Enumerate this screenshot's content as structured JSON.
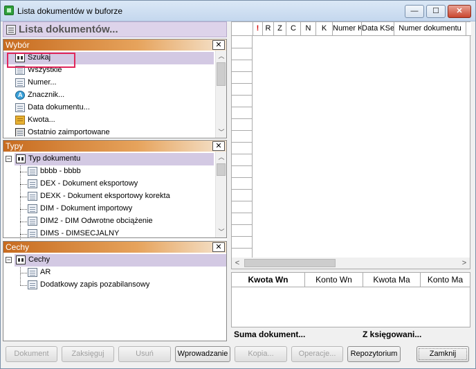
{
  "window": {
    "title": "Lista dokumentów w buforze",
    "min": "—",
    "max": "☐",
    "close": "✕"
  },
  "left_header": {
    "title": "Lista dokumentów..."
  },
  "wybor": {
    "title": "Wybór",
    "close": "✕",
    "items": [
      {
        "label": "Szukaj",
        "icon": "binoculars-icon"
      },
      {
        "label": "Wszystkie",
        "icon": "list-icon"
      },
      {
        "label": "Numer...",
        "icon": "list-icon"
      },
      {
        "label": "Znacznik...",
        "icon": "marker-icon"
      },
      {
        "label": "Data dokumentu...",
        "icon": "list-icon"
      },
      {
        "label": "Kwota...",
        "icon": "coins-icon"
      },
      {
        "label": "Ostatnio zaimportowane",
        "icon": "import-icon"
      }
    ]
  },
  "typy": {
    "title": "Typy",
    "close": "✕",
    "root": "Typ dokumentu",
    "items": [
      "bbbb - bbbb",
      "DEX - Dokument eksportowy",
      "DEXK - Dokument eksportowy korekta",
      "DIM - Dokument importowy",
      "DIM2 - DIM Odwrotne obciążenie",
      "DIMS - DIMSECJALNY"
    ]
  },
  "cechy": {
    "title": "Cechy",
    "close": "✕",
    "root": "Cechy",
    "items": [
      "AR",
      "Dodatkowy zapis pozabilansowy"
    ]
  },
  "grid": {
    "columns": [
      "!",
      "R",
      "Z",
      "C",
      "N",
      "K",
      "Numer K",
      "Data KSe",
      "Numer dokumentu"
    ],
    "scroll_left": "<",
    "scroll_right": ">"
  },
  "summary": {
    "columns": [
      "Kwota Wn",
      "Konto Wn",
      "Kwota Ma",
      "Konto Ma"
    ],
    "suma": "Suma dokument...",
    "zksiegowani": "Z księgowani..."
  },
  "buttons": {
    "dokument": "Dokument",
    "zaksieguj": "Zaksięguj",
    "usun": "Usuń",
    "wprowadzanie": "Wprowadzanie",
    "kopia": "Kopia...",
    "operacje": "Operacje...",
    "repozytorium": "Repozytorium",
    "zamknij": "Zamknij"
  },
  "colors": {
    "section_title": "#c76b1f",
    "selection": "#d3c9e3",
    "highlight": "#e0265a"
  }
}
